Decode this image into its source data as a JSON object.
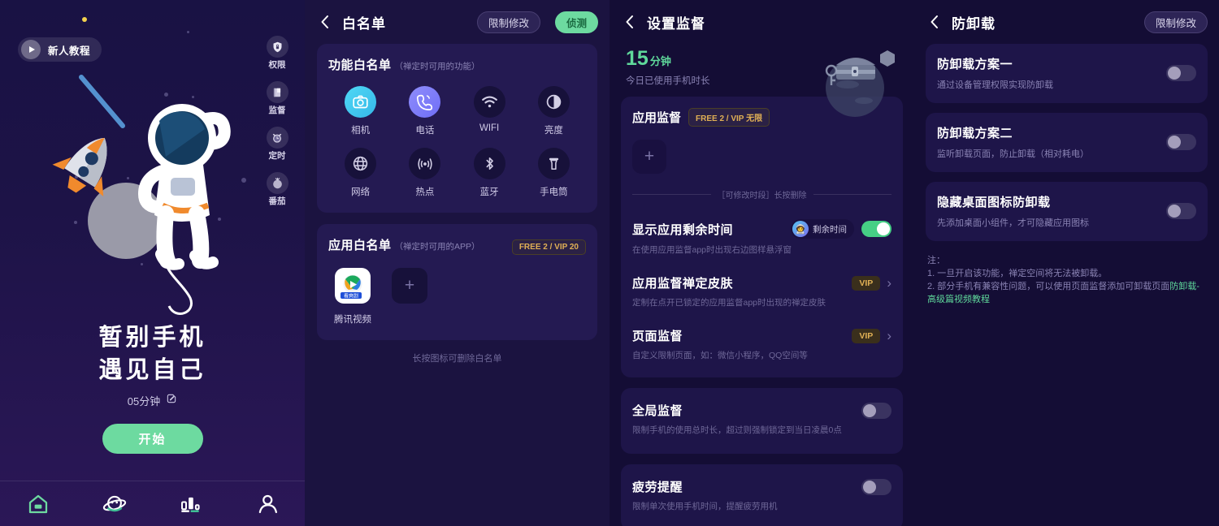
{
  "panel1": {
    "tutorial": {
      "label": "新人教程",
      "icon": "play-icon"
    },
    "side_tools": [
      {
        "label": "权限",
        "icon": "shield-lock-icon"
      },
      {
        "label": "监督",
        "icon": "book-icon"
      },
      {
        "label": "定时",
        "icon": "alarm-clock-icon"
      },
      {
        "label": "番茄",
        "icon": "tomato-icon"
      }
    ],
    "headline_line1": "暂别手机",
    "headline_line2": "遇见自己",
    "duration": "05分钟",
    "edit_icon": "edit-pencil-icon",
    "start_label": "开始",
    "tabs": [
      {
        "name": "home",
        "icon": "home-icon",
        "active": true
      },
      {
        "name": "planet",
        "icon": "planet-icon",
        "active": false
      },
      {
        "name": "stats",
        "icon": "bar-chart-icon",
        "active": false
      },
      {
        "name": "profile",
        "icon": "person-icon",
        "active": false
      }
    ],
    "accent_green": "#6ddaa0"
  },
  "panel2": {
    "nav": {
      "back_icon": "chevron-left-icon",
      "title": "白名单",
      "chip_restrict": "限制修改",
      "chip_detect": "侦测"
    },
    "feature_card": {
      "title": "功能白名单",
      "subtitle": "（禅定时可用的功能）",
      "items": [
        {
          "label": "相机",
          "icon": "camera-icon",
          "style": "cyan"
        },
        {
          "label": "电话",
          "icon": "phone-icon",
          "style": "blue"
        },
        {
          "label": "WIFI",
          "icon": "wifi-icon",
          "style": "dark"
        },
        {
          "label": "亮度",
          "icon": "brightness-icon",
          "style": "dark"
        },
        {
          "label": "网络",
          "icon": "globe-icon",
          "style": "dark"
        },
        {
          "label": "热点",
          "icon": "hotspot-icon",
          "style": "dark"
        },
        {
          "label": "蓝牙",
          "icon": "bluetooth-icon",
          "style": "dark"
        },
        {
          "label": "手电筒",
          "icon": "flashlight-icon",
          "style": "dark"
        }
      ]
    },
    "app_card": {
      "title": "应用白名单",
      "subtitle": "（禅定时可用的APP）",
      "badge": "FREE 2 / VIP 20",
      "apps": [
        {
          "label": "腾讯视频",
          "icon": "tencent-video-icon"
        }
      ],
      "add_icon": "plus-icon"
    },
    "hint": "长按图标可删除白名单"
  },
  "panel3": {
    "nav": {
      "back_icon": "chevron-left-icon",
      "title": "设置监督"
    },
    "stat": {
      "value": "15",
      "unit": "分钟",
      "label": "今日已使用手机时长"
    },
    "illustration": "treasure-chest-planet-icon",
    "app_supervise": {
      "title": "应用监督",
      "badge": "FREE 2 / VIP 无限",
      "add_icon": "plus-icon",
      "divider_text": "［可修改时段］长按删除"
    },
    "rows": [
      {
        "title": "显示应用剩余时间",
        "desc": "在使用应用监督app时出现右边图样悬浮窗",
        "control": "toggle-on",
        "pill": "剩余时间"
      },
      {
        "title": "应用监督禅定皮肤",
        "desc": "定制在点开已锁定的应用监督app时出现的禅定皮肤",
        "control": "vip-chevron",
        "vip": "VIP"
      },
      {
        "title": "页面监督",
        "desc": "自定义限制页面，如：微信小程序，QQ空间等",
        "control": "vip-chevron",
        "vip": "VIP"
      }
    ],
    "rows2": [
      {
        "title": "全局监督",
        "desc": "限制手机的使用总时长，超过则强制锁定到当日凌晨0点",
        "control": "toggle-off"
      },
      {
        "title": "疲劳提醒",
        "desc": "限制单次使用手机时间，提醒疲劳用机",
        "control": "toggle-off"
      }
    ]
  },
  "panel4": {
    "nav": {
      "back_icon": "chevron-left-icon",
      "title": "防卸载",
      "chip_restrict": "限制修改"
    },
    "cards": [
      {
        "title": "防卸载方案一",
        "desc": "通过设备管理权限实现防卸载",
        "toggle": "off"
      },
      {
        "title": "防卸载方案二",
        "desc": "监听卸载页面，防止卸载（相对耗电）",
        "toggle": "off"
      },
      {
        "title": "隐藏桌面图标防卸载",
        "desc": "先添加桌面小组件，才可隐藏应用图标",
        "toggle": "off"
      }
    ],
    "note_head": "注：",
    "note_1": "1. 一旦开启该功能，禅定空间将无法被卸载。",
    "note_2_pre": "2. 部分手机有兼容性问题，可以使用页面监督添加可卸载页面",
    "note_2_link": "防卸载-高级篇视频教程"
  }
}
